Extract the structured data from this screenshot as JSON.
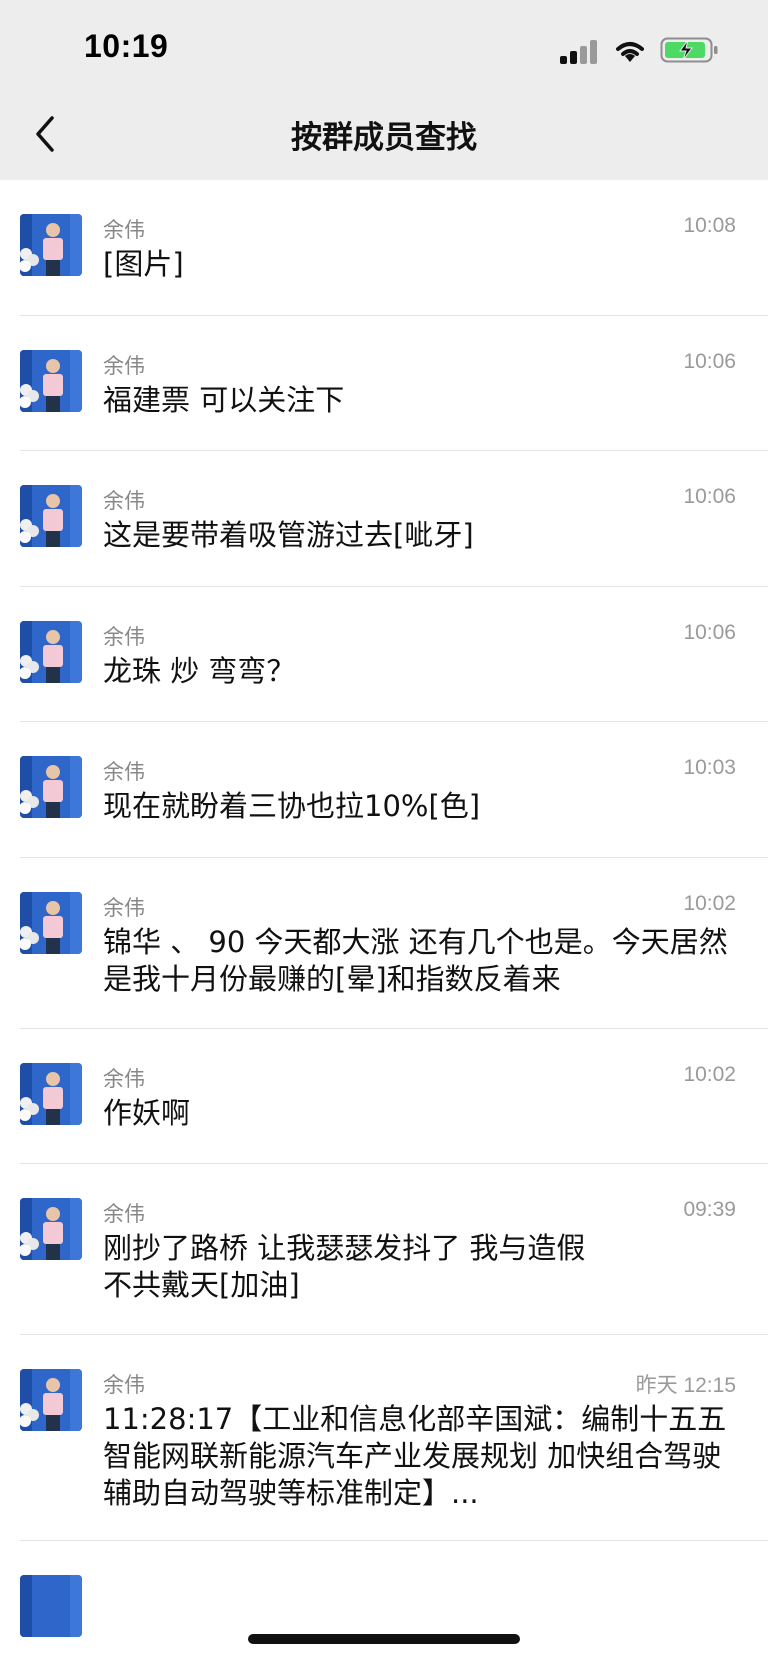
{
  "status_bar": {
    "time": "10:19"
  },
  "nav": {
    "title": "按群成员查找"
  },
  "messages": [
    {
      "sender": "余伟",
      "time": "10:08",
      "text": "[图片]"
    },
    {
      "sender": "余伟",
      "time": "10:06",
      "text": "福建票 可以关注下"
    },
    {
      "sender": "余伟",
      "time": "10:06",
      "text": "这是要带着吸管游过去[呲牙]"
    },
    {
      "sender": "余伟",
      "time": "10:06",
      "text": "龙珠 炒 弯弯？"
    },
    {
      "sender": "余伟",
      "time": "10:03",
      "text": "现在就盼着三协也拉10%[色]"
    },
    {
      "sender": "余伟",
      "time": "10:02",
      "text": "锦华 、 90 今天都大涨 还有几个也是。今天居然是我十月份最赚的[晕]和指数反着来"
    },
    {
      "sender": "余伟",
      "time": "10:02",
      "text": "作妖啊"
    },
    {
      "sender": "余伟",
      "time": "09:39",
      "text": "刚抄了路桥 让我瑟瑟发抖了 我与造假不共戴天[加油]"
    },
    {
      "sender": "余伟",
      "time": "昨天 12:15",
      "text": "11:28:17【工业和信息化部辛国斌：编制十五五智能网联新能源汽车产业发展规划 加快组合驾驶辅助自动驾驶等标准制定】..."
    }
  ],
  "colors": {
    "topbar": "#ededed",
    "battery_fill": "#4cd964"
  }
}
